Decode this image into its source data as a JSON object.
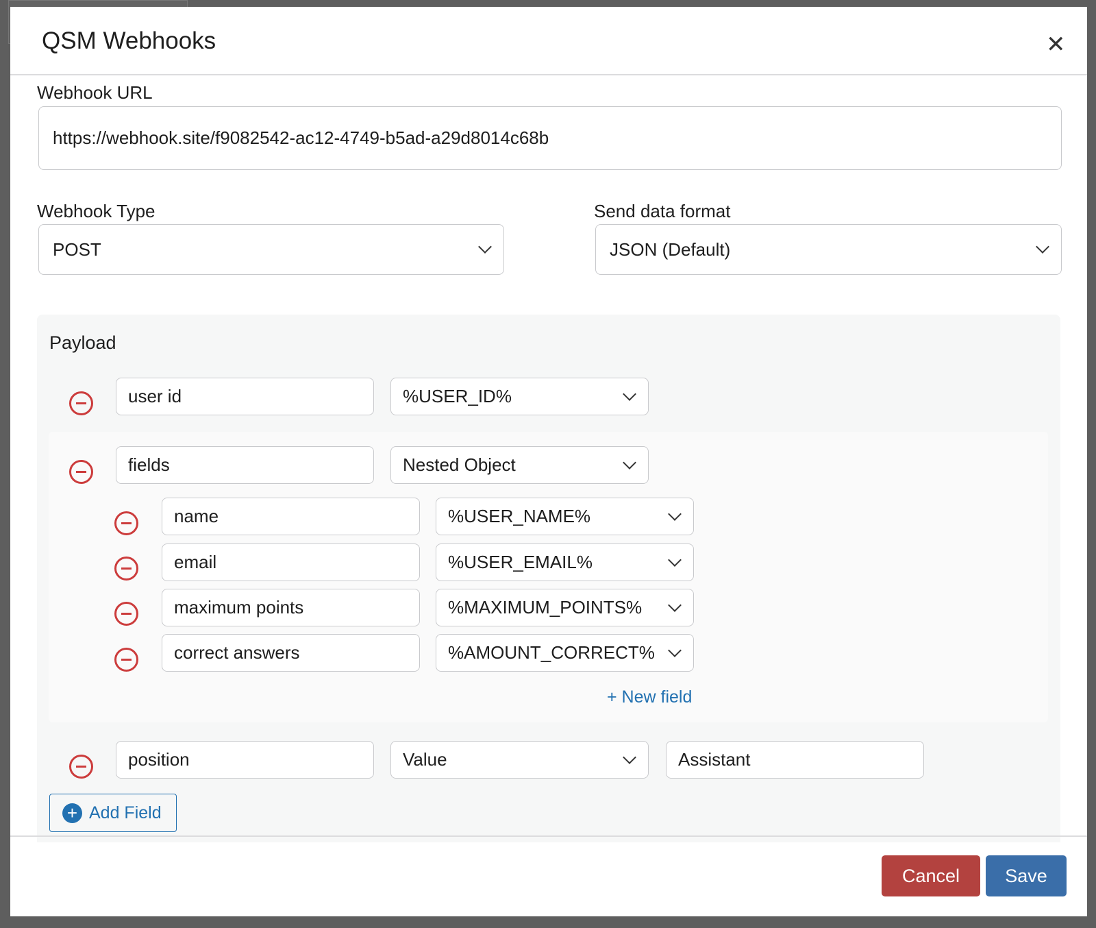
{
  "modal": {
    "title": "QSM Webhooks",
    "close_icon": "close-icon"
  },
  "url": {
    "label": "Webhook URL",
    "value": "https://webhook.site/f9082542-ac12-4749-b5ad-a29d8014c68b"
  },
  "type": {
    "label": "Webhook Type",
    "value": "POST"
  },
  "format": {
    "label": "Send data format",
    "value": "JSON (Default)"
  },
  "payload": {
    "title": "Payload",
    "rows": [
      {
        "key": "user id",
        "value": "%USER_ID%"
      },
      {
        "key": "fields",
        "value": "Nested Object"
      },
      {
        "key": "position",
        "value": "Value",
        "extra": "Assistant"
      }
    ],
    "nested": [
      {
        "key": "name",
        "value": "%USER_NAME%"
      },
      {
        "key": "email",
        "value": "%USER_EMAIL%"
      },
      {
        "key": "maximum points",
        "value": "%MAXIMUM_POINTS%"
      },
      {
        "key": "correct answers",
        "value": "%AMOUNT_CORRECT%"
      }
    ],
    "new_field": "+ New field",
    "add_field": "Add Field"
  },
  "footer": {
    "cancel": "Cancel",
    "save": "Save"
  },
  "colors": {
    "danger": "#cc3c3c",
    "primary": "#2271b1",
    "cancel_bg": "#b3423f",
    "save_bg": "#3a6ea9"
  }
}
